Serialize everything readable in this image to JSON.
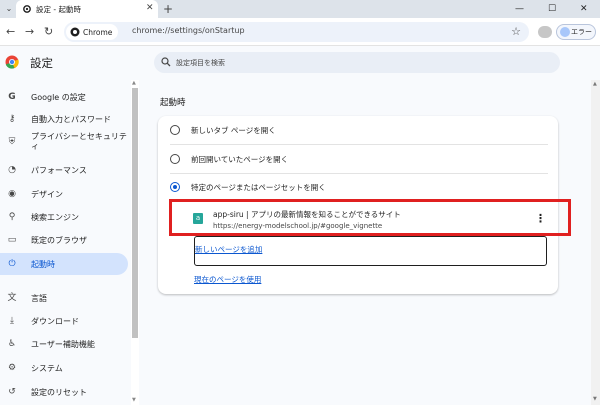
{
  "browser": {
    "tab_title": "設定 - 起動時",
    "tab_menu_icon": "chevron-down-icon",
    "tab_close_glyph": "✕",
    "new_tab_glyph": "+",
    "window": {
      "minimize": "—",
      "maximize": "☐",
      "close": "✕"
    },
    "chip_label": "Chrome",
    "url": "chrome://settings/onStartup",
    "profile_label": "エラー"
  },
  "settings": {
    "title": "設定",
    "search_placeholder": "設定項目を検索"
  },
  "sidebar": {
    "items": [
      {
        "label": "Google の設定",
        "icon": "google-icon",
        "glyph": "G"
      },
      {
        "label": "自動入力とパスワード",
        "icon": "key-icon",
        "glyph": "⚷"
      },
      {
        "label": "プライバシーとセキュリティ",
        "icon": "shield-icon",
        "glyph": "⛨"
      },
      {
        "label": "パフォーマンス",
        "icon": "speed-icon",
        "glyph": "◔"
      },
      {
        "label": "デザイン",
        "icon": "palette-icon",
        "glyph": "◉"
      },
      {
        "label": "検索エンジン",
        "icon": "search-icon",
        "glyph": "⚲"
      },
      {
        "label": "既定のブラウザ",
        "icon": "browser-icon",
        "glyph": "▭"
      },
      {
        "label": "起動時",
        "icon": "power-icon",
        "glyph": "⏻"
      },
      {
        "label": "言語",
        "icon": "translate-icon",
        "glyph": "文"
      },
      {
        "label": "ダウンロード",
        "icon": "download-icon",
        "glyph": "⤓"
      },
      {
        "label": "ユーザー補助機能",
        "icon": "accessibility-icon",
        "glyph": "♿"
      },
      {
        "label": "システム",
        "icon": "wrench-icon",
        "glyph": "⚙"
      },
      {
        "label": "設定のリセット",
        "icon": "reset-icon",
        "glyph": "↺"
      }
    ]
  },
  "main": {
    "section_title": "起動時",
    "options": [
      {
        "label": "新しいタブ ページを開く",
        "selected": false
      },
      {
        "label": "前回開いていたページを開く",
        "selected": false
      },
      {
        "label": "特定のページまたはページセットを開く",
        "selected": true
      }
    ],
    "startup_page": {
      "title": "app-siru | アプリの最新情報を知ることができるサイト",
      "url": "https://energy-modelschool.jp/#google_vignette",
      "favicon_letter": "a",
      "menu_glyph": "⋮"
    },
    "add_page_label": "新しいページを追加",
    "use_current_label": "現在のページを使用"
  },
  "colors": {
    "accent": "#0b57d0",
    "active_nav": "#d3e3fd",
    "highlight": "#e02020"
  }
}
